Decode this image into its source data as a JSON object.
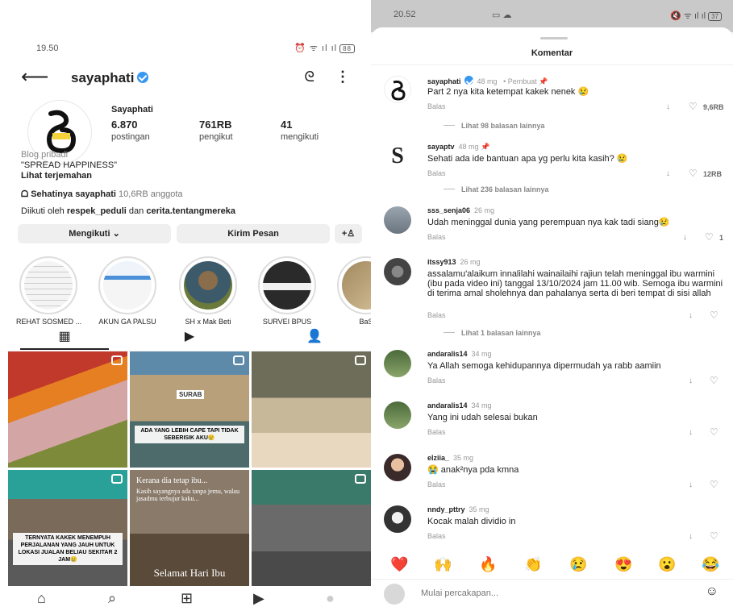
{
  "left": {
    "status": {
      "time": "19.50",
      "icons": "⏰ ᯤ ıl ıl",
      "battery": "88"
    },
    "header": {
      "username": "sayaphati",
      "back": "⟵",
      "threads": "ᘓ",
      "more": "⋮"
    },
    "profile": {
      "display_name": "Sayaphati",
      "posts": {
        "count": "6.870",
        "label": "postingan"
      },
      "followers": {
        "count": "761RB",
        "label": "pengikut"
      },
      "following": {
        "count": "41",
        "label": "mengikuti"
      },
      "category": "Blog pribadi",
      "bio": "\"SPREAD HAPPINESS\"",
      "translate": "Lihat terjemahan",
      "community": {
        "name": "Sehatinya sayaphati",
        "members": "10,6RB anggota"
      },
      "followed_by_prefix": "Diikuti oleh",
      "followed_by_1": "respek_peduli",
      "followed_by_and": "dan",
      "followed_by_2": "cerita.tentangmereka"
    },
    "buttons": {
      "following": "Mengikuti ⌄",
      "message": "Kirim Pesan",
      "add": "+♙"
    },
    "highlights": [
      {
        "label": "REHAT SOSMED ..."
      },
      {
        "label": "AKUN GA PALSU"
      },
      {
        "label": "SH x Mak Beti"
      },
      {
        "label": "SURVEI BPUS"
      },
      {
        "label": "BaS"
      }
    ],
    "tabs": {
      "grid": "▦",
      "reels": "▶",
      "tagged": "👤"
    },
    "posts": [
      {
        "caption": ""
      },
      {
        "caption": "ADA YANG LEBIH CAPE TAPI TIDAK SEBERISIK AKU😢",
        "sign": "SURAB"
      },
      {
        "caption": ""
      },
      {
        "caption": "TERNYATA KAKEK MENEMPUH PERJALANAN YANG JAUH UNTUK LOKASI JUALAN BELIAU SEKITAR 2 JAM😢"
      },
      {
        "line1": "Kerana dia tetap ibu...",
        "line2": "Kasih sayangnya ada tanpa jemu, walau jasadmu terbujur kaku...",
        "footer": "Selamat Hari Ibu"
      },
      {
        "caption": ""
      }
    ],
    "nav": {
      "home": "⌂",
      "search": "⌕",
      "add": "⊞",
      "reels": "▶",
      "profile": "●"
    }
  },
  "right": {
    "status": {
      "time": "20.52",
      "mid": "▭ ☁",
      "icons": "🔇 ᯤ ıl ıl",
      "battery": "37"
    },
    "title": "Komentar",
    "comments": [
      {
        "user": "sayaphati",
        "time": "48 mg",
        "extra": "• Pembuat 📌",
        "text": "Part 2 nya kita ketempat kakek nenek 😢",
        "reply": "Balas",
        "likes": "9,6RB",
        "more": "Lihat 98 balasan lainnya"
      },
      {
        "user": "sayaptv",
        "time": "48 mg 📌",
        "extra": "",
        "text": "Sehati ada ide bantuan apa yg perlu kita kasih? 😢",
        "reply": "Balas",
        "likes": "12RB",
        "more": "Lihat 236 balasan lainnya"
      },
      {
        "user": "sss_senja06",
        "time": "26 mg",
        "extra": "",
        "text": "Udah meninggal dunia yang perempuan nya kak tadi siang😢",
        "reply": "Balas",
        "likes": "1",
        "more": ""
      },
      {
        "user": "itssy913",
        "time": "26 mg",
        "extra": "",
        "text": "assalamu'alaikum innalilahi wainailaihi rajiun telah meninggal ibu warmini (ibu pada video ini) tanggal 13/10/2024 jam 11.00 wib. Semoga ibu warmini di terima amal sholehnya dan pahalanya serta di beri tempat di sisi allah",
        "reply": "Balas",
        "likes": "",
        "more": "Lihat 1 balasan lainnya"
      },
      {
        "user": "andaralis14",
        "time": "34 mg",
        "extra": "",
        "text": "Ya Allah semoga kehidupannya dipermudah ya rabb aamiin",
        "reply": "Balas",
        "likes": "",
        "more": ""
      },
      {
        "user": "andaralis14",
        "time": "34 mg",
        "extra": "",
        "text": "Yang ini udah selesai bukan",
        "reply": "Balas",
        "likes": "",
        "more": ""
      },
      {
        "user": "elziia_",
        "time": "35 mg",
        "extra": "",
        "text": "😭 anak²nya pda kmna",
        "reply": "Balas",
        "likes": "",
        "more": ""
      },
      {
        "user": "nndy_pttry",
        "time": "35 mg",
        "extra": "",
        "text": "Kocak malah dividio in",
        "reply": "Balas",
        "likes": "",
        "more": ""
      }
    ],
    "emojis": [
      "❤️",
      "🙌",
      "🔥",
      "👏",
      "😢",
      "😍",
      "😮",
      "😂"
    ],
    "input": {
      "placeholder": "Mulai percakapan..."
    },
    "sticker": "☺"
  }
}
